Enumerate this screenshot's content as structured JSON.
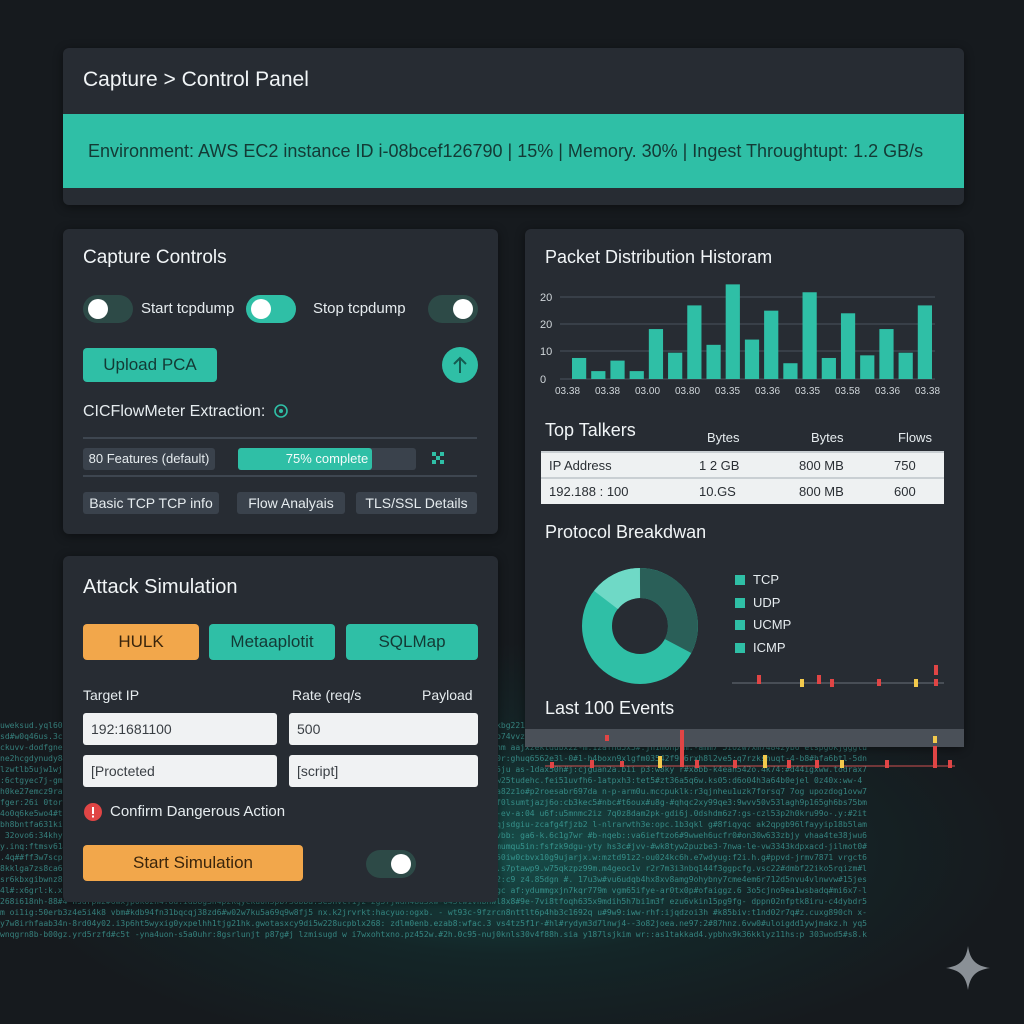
{
  "header": {
    "breadcrumb": "Capture > Control Panel",
    "environment": "Environment: AWS EC2 instance ID i-08bcef126790 | 15% | Memory. 30% | Ingest Throughtupt: 1.2 GB/s"
  },
  "capture": {
    "title": "Capture Controls",
    "start_label": "Start tcpdump",
    "stop_label": "Stop tcpdump",
    "upload_label": "Upload PCA",
    "cicflow_label": "CICFlowMeter Extraction:",
    "features_label": "80 Features (default)",
    "progress_label": "75% complete",
    "progress_value": 0.75,
    "tabs": [
      "Basic TCP   TCP info",
      "Flow Analyais",
      "TLS/SSL Details"
    ]
  },
  "attack": {
    "title": "Attack Simulation",
    "tools": [
      "HULK",
      "Metaaplotit",
      "SQLMap"
    ],
    "target_ip_label": "Target IP",
    "rate_label": "Rate (req/s",
    "payload_label": "Payload",
    "target_ip_value": "192:1681100",
    "rate_value": "500",
    "protected_value": "[Procteted",
    "script_value": "[script]",
    "confirm_label": "Confirm Dangerous Action",
    "start_label": "Start Simulation"
  },
  "histogram": {
    "title": "Packet Distribution Historam",
    "ytick_labels": [
      "20",
      "20",
      "10",
      "0"
    ],
    "xtick_labels": [
      "03.38",
      "03.38",
      "03.00",
      "03.80",
      "03.35",
      "03.36",
      "03.35",
      "03.58",
      "03.36",
      "03.38"
    ]
  },
  "talkers": {
    "title": "Top Talkers",
    "columns": [
      "Bytes",
      "Bytes",
      "Flows"
    ],
    "rows": [
      [
        "IP Address",
        "1 2 GB",
        "800 MB",
        "750"
      ],
      [
        "192.188 : 100",
        "10.GS",
        "800 MB",
        "600"
      ]
    ]
  },
  "protocol": {
    "title": "Protocol Breakdwan",
    "legend": [
      "TCP",
      "UDP",
      "UCMP",
      "ICMP"
    ]
  },
  "events": {
    "title": "Last 100 Events"
  },
  "colors": {
    "accent": "#2fbfa6",
    "orange": "#f2a74b",
    "panel": "#272c33",
    "background": "#161a1e"
  },
  "chart_data": {
    "type": "bar",
    "title": "Packet Distribution Historam",
    "ylim": [
      0,
      35
    ],
    "values": [
      8,
      3,
      7,
      3,
      19,
      10,
      28,
      13,
      36,
      15,
      26,
      6,
      33,
      8,
      25,
      9,
      19,
      10,
      28
    ]
  }
}
